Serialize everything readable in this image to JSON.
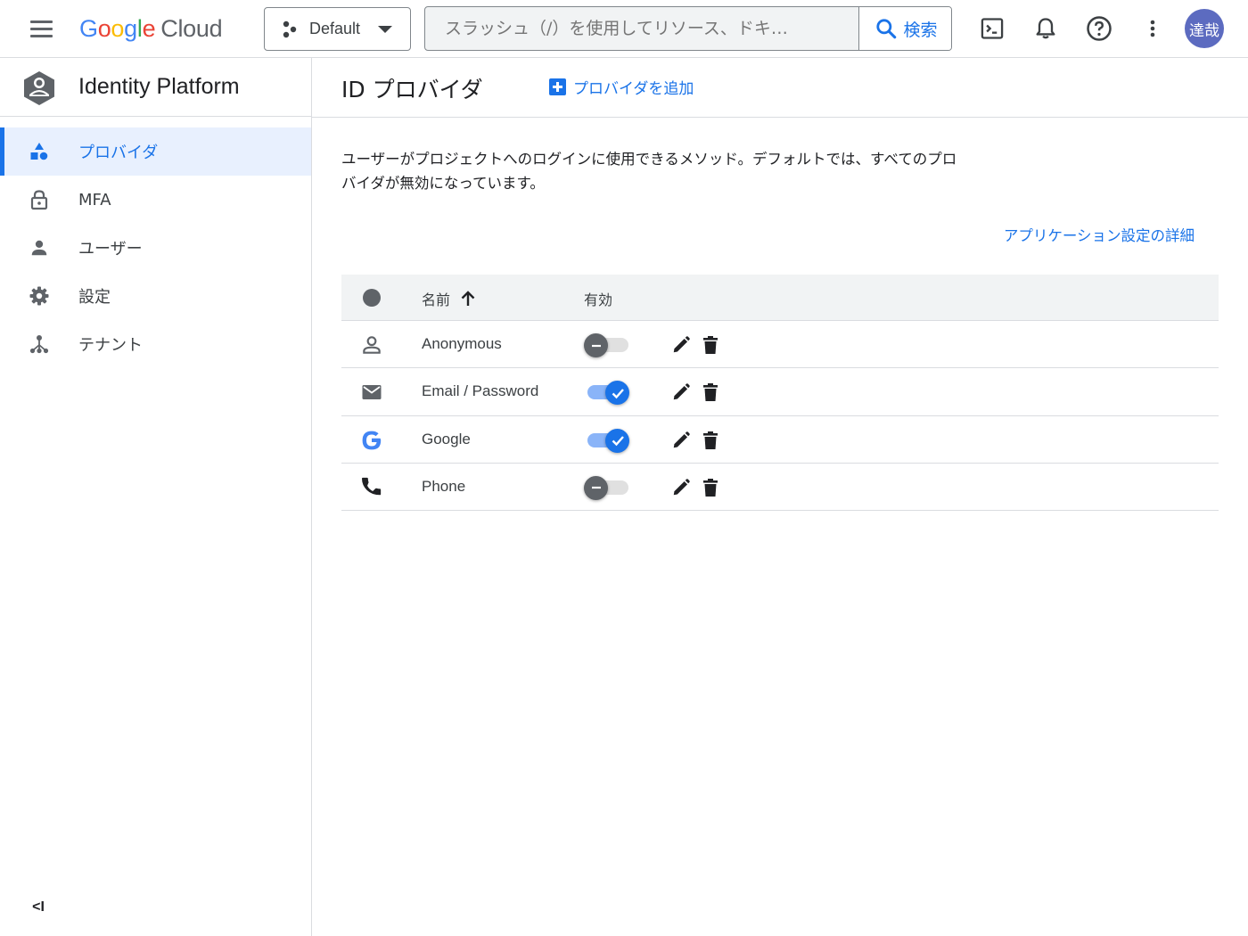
{
  "topbar": {
    "logo": {
      "google": [
        "G",
        "o",
        "o",
        "g",
        "l",
        "e"
      ],
      "cloud": "Cloud"
    },
    "project": "Default",
    "search": {
      "placeholder": "スラッシュ（/）を使用してリソース、ドキ…",
      "button_label": "検索"
    },
    "avatar_text": "達哉"
  },
  "colors": {
    "accent": "#1a73e8",
    "active_bg": "#e8f0fe",
    "toggle_on_track": "#8ab4f8",
    "toggle_off_knob": "#5f6368",
    "avatar": "#5c6bc0"
  },
  "sidebar": {
    "product_title": "Identity Platform",
    "items": [
      {
        "label": "プロバイダ",
        "icon": "shapes-icon",
        "active": true
      },
      {
        "label": "MFA",
        "icon": "lock-icon",
        "active": false
      },
      {
        "label": "ユーザー",
        "icon": "person-icon",
        "active": false
      },
      {
        "label": "設定",
        "icon": "gear-icon",
        "active": false
      },
      {
        "label": "テナント",
        "icon": "tenant-icon",
        "active": false
      }
    ],
    "collapse_label": "<I"
  },
  "main": {
    "title": "ID プロバイダ",
    "add_provider_label": "プロバイダを追加",
    "description": "ユーザーがプロジェクトへのログインに使用できるメソッド。デフォルトでは、すべてのプロバイダが無効になっています。",
    "app_settings_link": "アプリケーション設定の詳細",
    "table": {
      "columns": {
        "name": "名前",
        "enabled": "有効"
      },
      "sort": {
        "column": "name",
        "direction": "ascending"
      },
      "rows": [
        {
          "name": "Anonymous",
          "icon": "person-outline-icon",
          "enabled": false
        },
        {
          "name": "Email / Password",
          "icon": "mail-icon",
          "enabled": true
        },
        {
          "name": "Google",
          "icon": "google-icon",
          "enabled": true
        },
        {
          "name": "Phone",
          "icon": "phone-icon",
          "enabled": false
        }
      ]
    }
  }
}
